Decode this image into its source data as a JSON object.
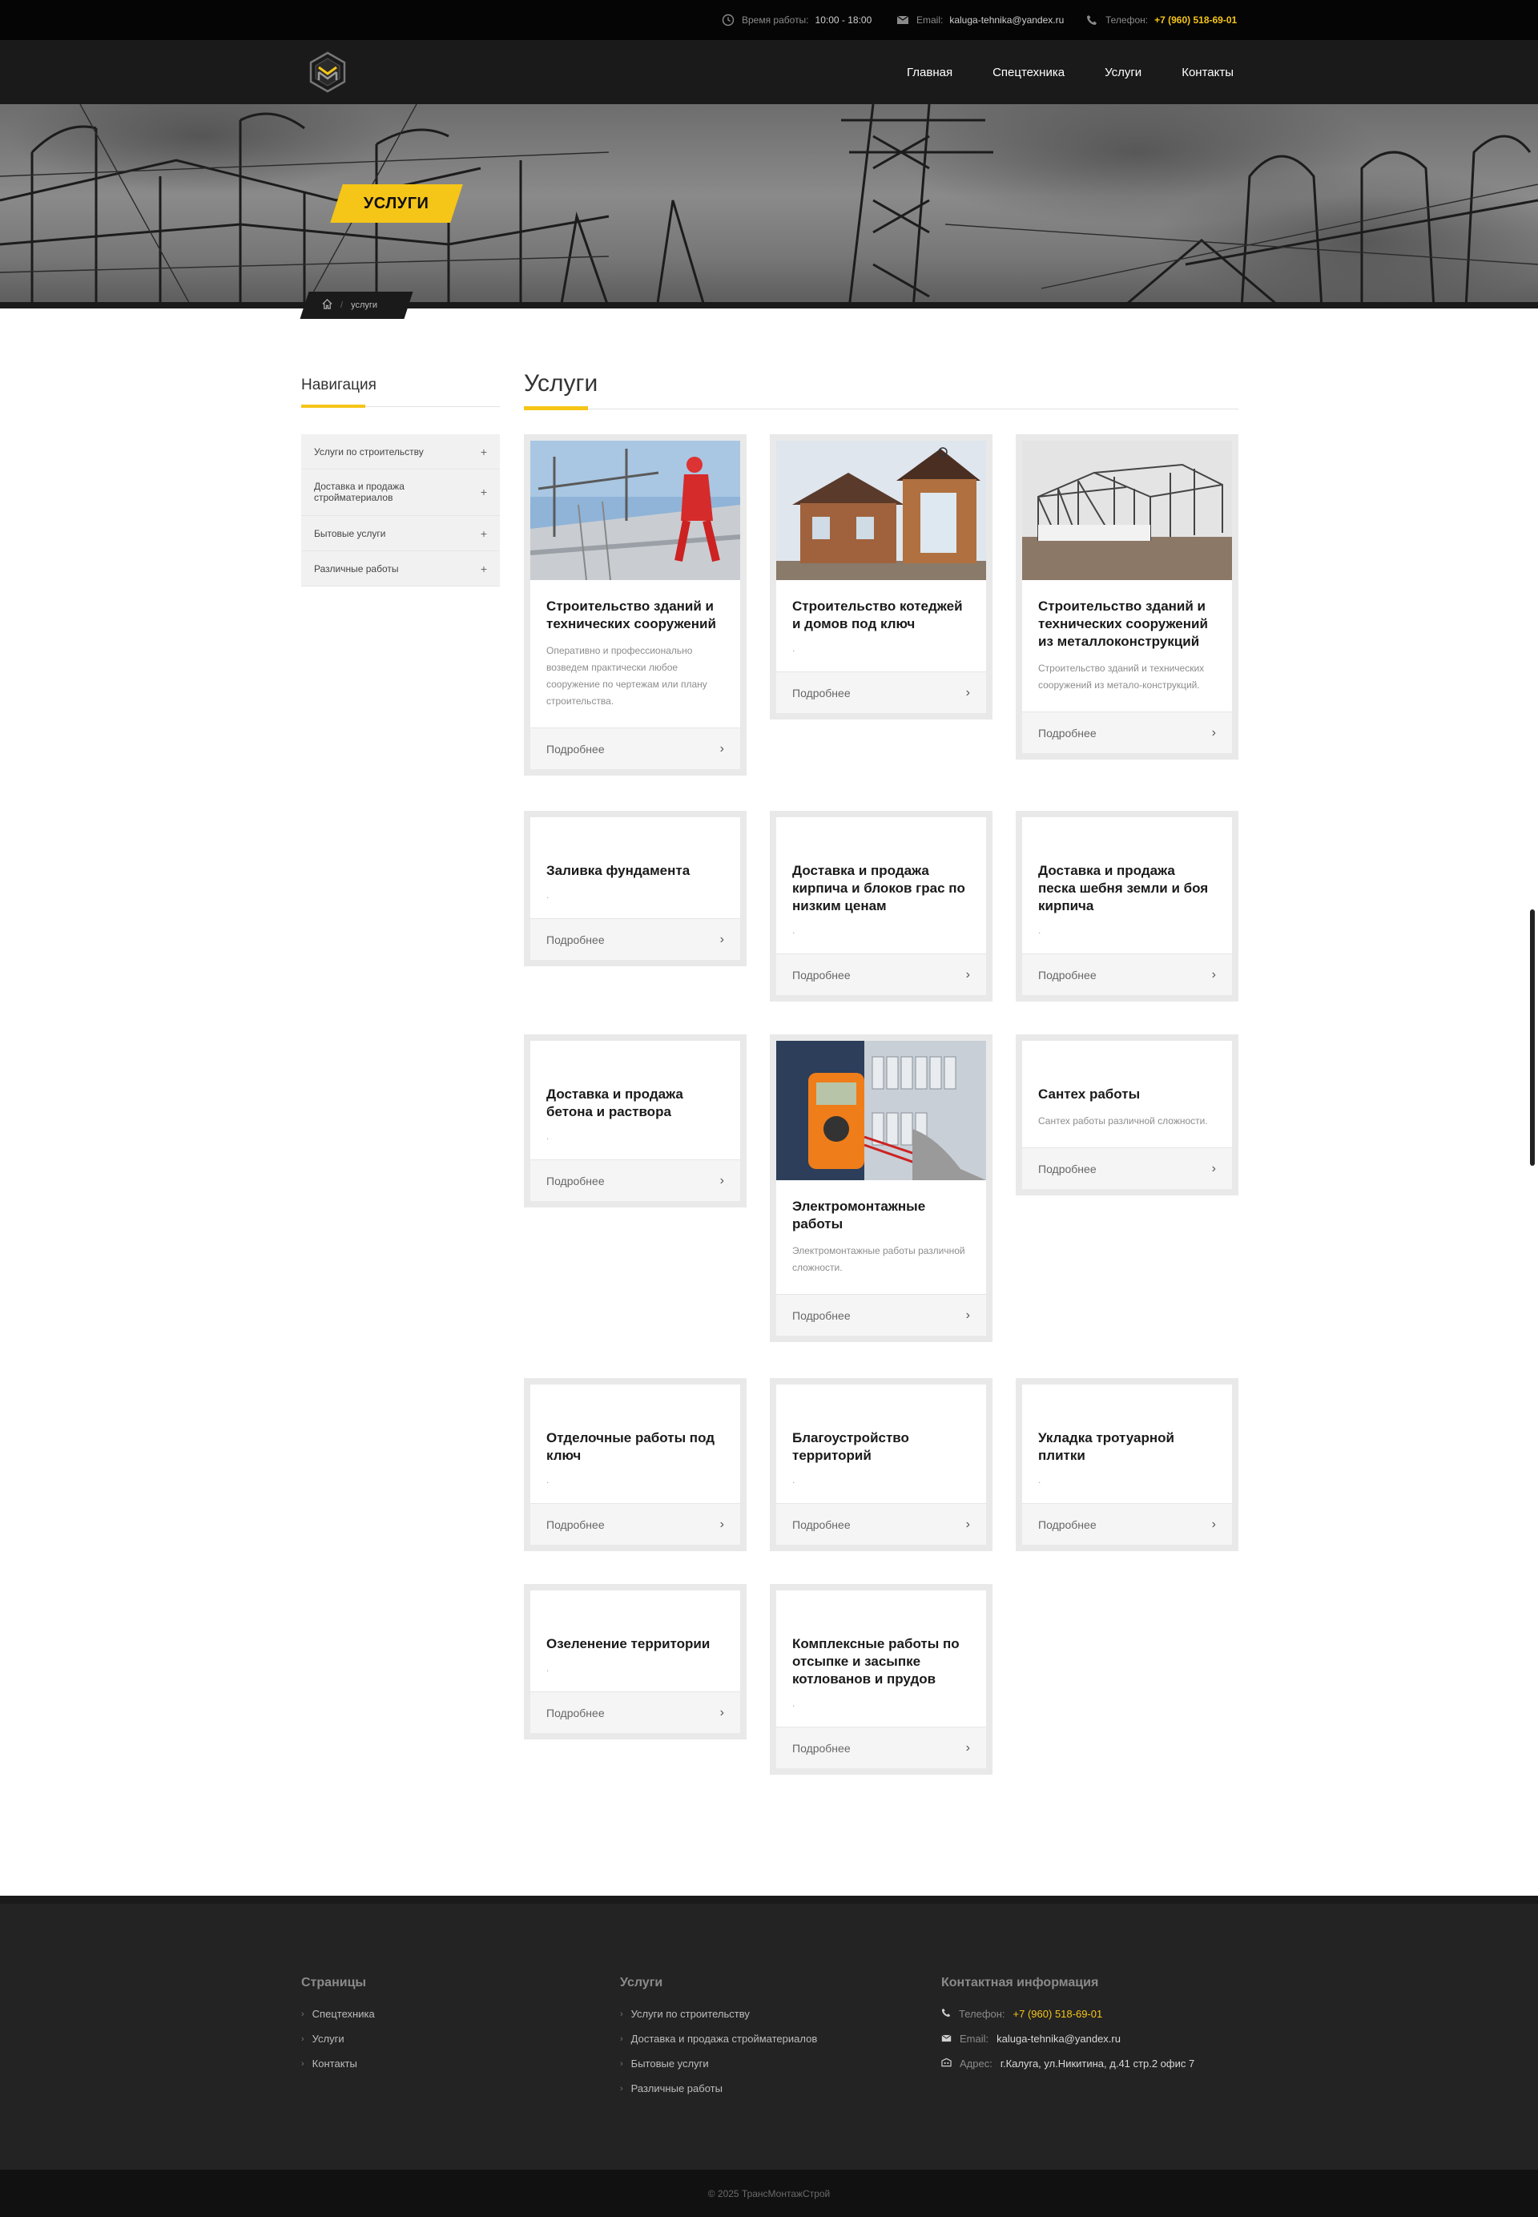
{
  "topbar": {
    "hours_label": "Время работы:",
    "hours_value": "10:00 - 18:00",
    "email_label": "Email:",
    "email_value": "kaluga-tehnika@yandex.ru",
    "phone_label": "Телефон:",
    "phone_value": "+7 (960) 518-69-01"
  },
  "nav": {
    "items": [
      "Главная",
      "Спецтехника",
      "Услуги",
      "Контакты"
    ]
  },
  "hero": {
    "title": "УСЛУГИ",
    "breadcrumb_current": "услуги"
  },
  "sidebar": {
    "title": "Навигация",
    "items": [
      {
        "label": "Услуги по строительству"
      },
      {
        "label": "Доставка и продажа стройматериалов"
      },
      {
        "label": "Бытовые услуги"
      },
      {
        "label": "Различные работы"
      }
    ]
  },
  "main": {
    "title": "Услуги",
    "more_label": "Подробнее",
    "cards": [
      {
        "title": "Строительство зданий и технических сооружений",
        "desc": "Оперативно и профессионально возведем практически любое сооружение по чертежам или плану строительства.",
        "image": "construction-worker-photo"
      },
      {
        "title": "Строительство котеджей и домов под ключ",
        "desc": ".",
        "image": "brick-house-photo"
      },
      {
        "title": "Строительство зданий и технических сооружений из металлоконструкций",
        "desc": "Строительство зданий и технических сооружений из метало-конструкций.",
        "image": "steel-frame-photo"
      },
      {
        "title": "Заливка фундамента",
        "desc": "."
      },
      {
        "title": "Доставка и продажа кирпича и блоков грас по низким ценам",
        "desc": "."
      },
      {
        "title": "Доставка и продажа песка шебня земли и боя кирпича",
        "desc": "."
      },
      {
        "title": "Доставка и продажа бетона и раствора",
        "desc": "."
      },
      {
        "title": "Электромонтажные работы",
        "desc": "Электромонтажные работы различной сложности.",
        "image": "multimeter-photo"
      },
      {
        "title": "Сантех работы",
        "desc": "Сантех работы различной сложности."
      },
      {
        "title": "Отделочные работы под ключ",
        "desc": "."
      },
      {
        "title": "Благоустройство территорий",
        "desc": "."
      },
      {
        "title": "Укладка тротуарной плитки",
        "desc": "."
      },
      {
        "title": "Озеленение территории",
        "desc": "."
      },
      {
        "title": "Комплексные работы по отсыпке и засыпке котлованов и прудов",
        "desc": "."
      }
    ]
  },
  "footer": {
    "pages_title": "Страницы",
    "pages": [
      "Спецтехника",
      "Услуги",
      "Контакты"
    ],
    "services_title": "Услуги",
    "services": [
      "Услуги по строительству",
      "Доставка и продажа стройматериалов",
      "Бытовые услуги",
      "Различные работы"
    ],
    "contacts_title": "Контактная информация",
    "phone_label": "Телефон:",
    "phone_value": "+7 (960) 518-69-01",
    "email_label": "Email:",
    "email_value": "kaluga-tehnika@yandex.ru",
    "address_label": "Адрес:",
    "address_value": "г.Калуга, ул.Никитина, д.41 стр.2 офис 7",
    "copyright": "© 2025 ТрансМонтажСтрой"
  },
  "colors": {
    "accent": "#f5c518",
    "dark": "#1a1a1a",
    "footer": "#232323"
  }
}
